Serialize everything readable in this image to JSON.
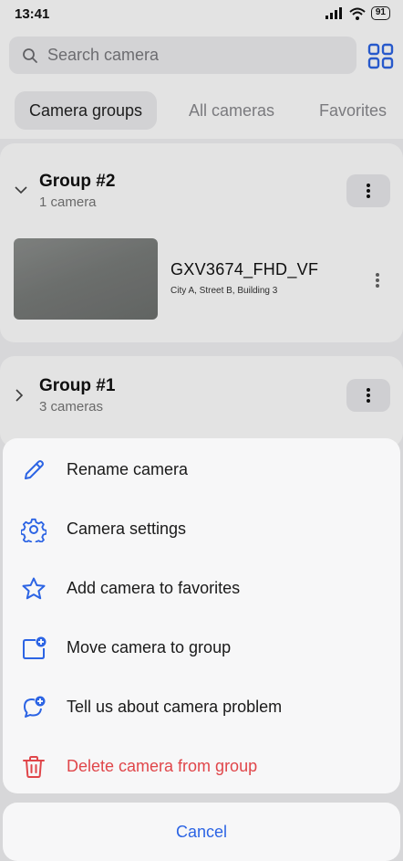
{
  "status_bar": {
    "time": "13:41",
    "battery": "91"
  },
  "search": {
    "placeholder": "Search camera"
  },
  "tabs": [
    {
      "label": "Camera groups",
      "active": true
    },
    {
      "label": "All cameras",
      "active": false
    },
    {
      "label": "Favorites",
      "active": false
    }
  ],
  "groups": [
    {
      "title": "Group #2",
      "subtitle": "1 camera",
      "expanded": true,
      "cameras": [
        {
          "name": "GXV3674_FHD_VF",
          "address": "City A, Street B, Building 3"
        }
      ]
    },
    {
      "title": "Group #1",
      "subtitle": "3 cameras",
      "expanded": false
    }
  ],
  "action_sheet": {
    "items": [
      {
        "label": "Rename camera",
        "icon": "pencil-icon"
      },
      {
        "label": "Camera settings",
        "icon": "gear-icon"
      },
      {
        "label": "Add camera to favorites",
        "icon": "star-icon"
      },
      {
        "label": "Move camera to group",
        "icon": "folder-plus-icon"
      },
      {
        "label": "Tell us about camera problem",
        "icon": "chat-plus-icon"
      },
      {
        "label": "Delete camera from group",
        "icon": "trash-icon",
        "danger": true
      }
    ],
    "cancel_label": "Cancel"
  },
  "colors": {
    "accent": "#2c64e4",
    "danger": "#e0464a"
  }
}
